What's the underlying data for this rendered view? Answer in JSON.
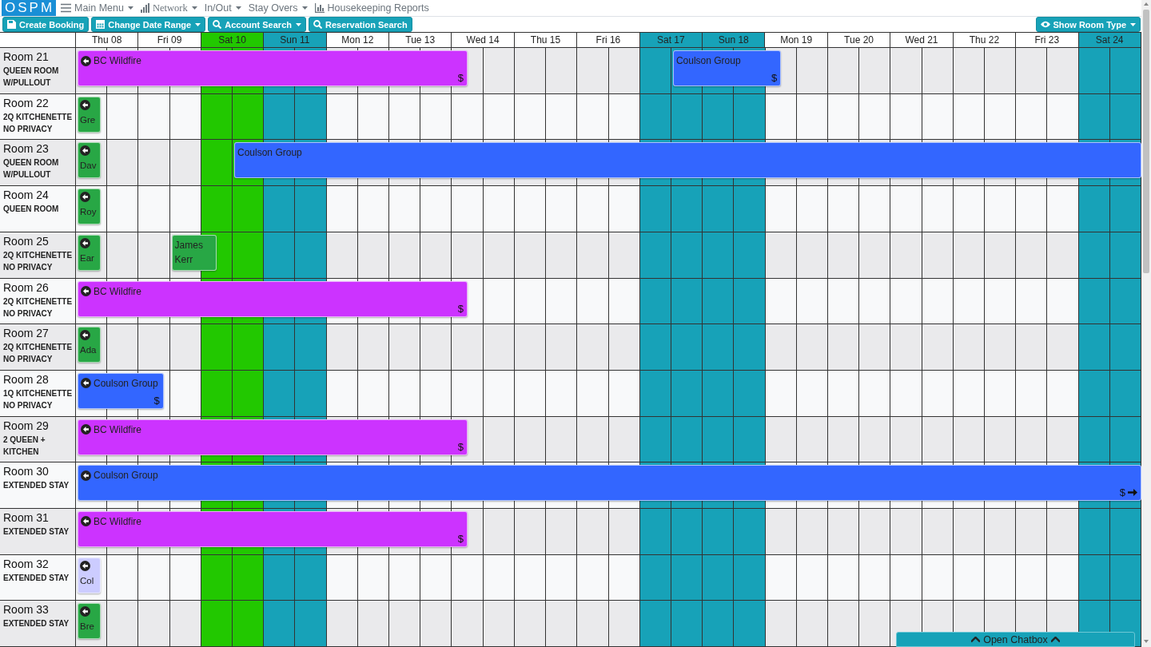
{
  "navbar": {
    "logo": "OSPM",
    "menus": [
      {
        "label": "Main Menu",
        "dropdown": true
      },
      {
        "label": "Network",
        "dropdown": true
      },
      {
        "label": "In/Out",
        "dropdown": true
      },
      {
        "label": "Stay Overs",
        "dropdown": true
      },
      {
        "label": "Housekeeping Reports",
        "dropdown": false
      }
    ]
  },
  "toolbar": {
    "left": [
      {
        "label": "Create Booking",
        "dropdown": false
      },
      {
        "label": "Change Date Range",
        "dropdown": true
      },
      {
        "label": "Account Search",
        "dropdown": true
      },
      {
        "label": "Reservation Search",
        "dropdown": false
      }
    ],
    "right": [
      {
        "label": "Show Room Type",
        "dropdown": true
      }
    ]
  },
  "days": [
    {
      "label": "Thu 08",
      "kind": "weekday"
    },
    {
      "label": "Fri 09",
      "kind": "weekday"
    },
    {
      "label": "Sat 10",
      "kind": "today"
    },
    {
      "label": "Sun 11",
      "kind": "weekend"
    },
    {
      "label": "Mon 12",
      "kind": "weekday"
    },
    {
      "label": "Tue 13",
      "kind": "weekday"
    },
    {
      "label": "Wed 14",
      "kind": "weekday"
    },
    {
      "label": "Thu 15",
      "kind": "weekday"
    },
    {
      "label": "Fri 16",
      "kind": "weekday"
    },
    {
      "label": "Sat 17",
      "kind": "weekend"
    },
    {
      "label": "Sun 18",
      "kind": "weekend"
    },
    {
      "label": "Mon 19",
      "kind": "weekday"
    },
    {
      "label": "Tue 20",
      "kind": "weekday"
    },
    {
      "label": "Wed 21",
      "kind": "weekday"
    },
    {
      "label": "Thu 22",
      "kind": "weekday"
    },
    {
      "label": "Fri 23",
      "kind": "weekday"
    },
    {
      "label": "Sat 24",
      "kind": "weekend"
    }
  ],
  "rooms": [
    {
      "name": "Room 21",
      "type": "QUEEN ROOM W/PULLOUT",
      "bookings": [
        {
          "guest": "BC Wildfire",
          "color": "#cc33ff",
          "continues_before": true,
          "payment": "$"
        },
        {
          "guest": "Coulson Group",
          "color": "#3366ff",
          "continues_before": false,
          "payment": "$"
        }
      ]
    },
    {
      "name": "Room 22",
      "type": "2Q KITCHENETTE NO PRIVACY",
      "bookings": [
        {
          "guest": "Gre",
          "color": "#28a745",
          "continues_before": true
        }
      ]
    },
    {
      "name": "Room 23",
      "type": "QUEEN ROOM W/PULLOUT",
      "bookings": [
        {
          "guest": "Dav",
          "color": "#28a745",
          "continues_before": true
        },
        {
          "guest": "Coulson Group",
          "color": "#3366ff",
          "continues_before": false
        }
      ]
    },
    {
      "name": "Room 24",
      "type": "QUEEN ROOM",
      "bookings": [
        {
          "guest": "Roy",
          "color": "#28a745",
          "continues_before": true
        }
      ]
    },
    {
      "name": "Room 25",
      "type": "2Q KITCHENETTE NO PRIVACY",
      "bookings": [
        {
          "guest": "Ear",
          "color": "#28a745",
          "continues_before": true
        },
        {
          "guest": "James Kerr",
          "color": "#28a745",
          "continues_before": false
        }
      ]
    },
    {
      "name": "Room 26",
      "type": "2Q KITCHENETTE NO PRIVACY",
      "bookings": [
        {
          "guest": "BC Wildfire",
          "color": "#cc33ff",
          "continues_before": true,
          "payment": "$"
        }
      ]
    },
    {
      "name": "Room 27",
      "type": "2Q KITCHENETTE NO PRIVACY",
      "bookings": [
        {
          "guest": "Ada",
          "color": "#28a745",
          "continues_before": true
        }
      ]
    },
    {
      "name": "Room 28",
      "type": "1Q KITCHENETTE NO PRIVACY",
      "bookings": [
        {
          "guest": "Coulson Group",
          "color": "#3366ff",
          "continues_before": true,
          "payment": "$"
        }
      ]
    },
    {
      "name": "Room 29",
      "type": "2 QUEEN + KITCHEN",
      "bookings": [
        {
          "guest": "BC Wildfire",
          "color": "#cc33ff",
          "continues_before": true,
          "payment": "$"
        }
      ]
    },
    {
      "name": "Room 30",
      "type": "EXTENDED STAY",
      "bookings": [
        {
          "guest": "Coulson Group",
          "color": "#3366ff",
          "continues_before": true,
          "continues_after": true,
          "payment": "$"
        }
      ]
    },
    {
      "name": "Room 31",
      "type": "EXTENDED STAY",
      "bookings": [
        {
          "guest": "BC Wildfire",
          "color": "#cc33ff",
          "continues_before": true,
          "payment": "$"
        }
      ]
    },
    {
      "name": "Room 32",
      "type": "EXTENDED STAY",
      "bookings": [
        {
          "guest": "Col",
          "color": "#ccccff",
          "continues_before": true
        }
      ]
    },
    {
      "name": "Room 33",
      "type": "EXTENDED STAY",
      "bookings": [
        {
          "guest": "Bre",
          "color": "#28a745",
          "continues_before": true
        }
      ]
    }
  ],
  "chatbox": {
    "label": "Open Chatbox"
  }
}
